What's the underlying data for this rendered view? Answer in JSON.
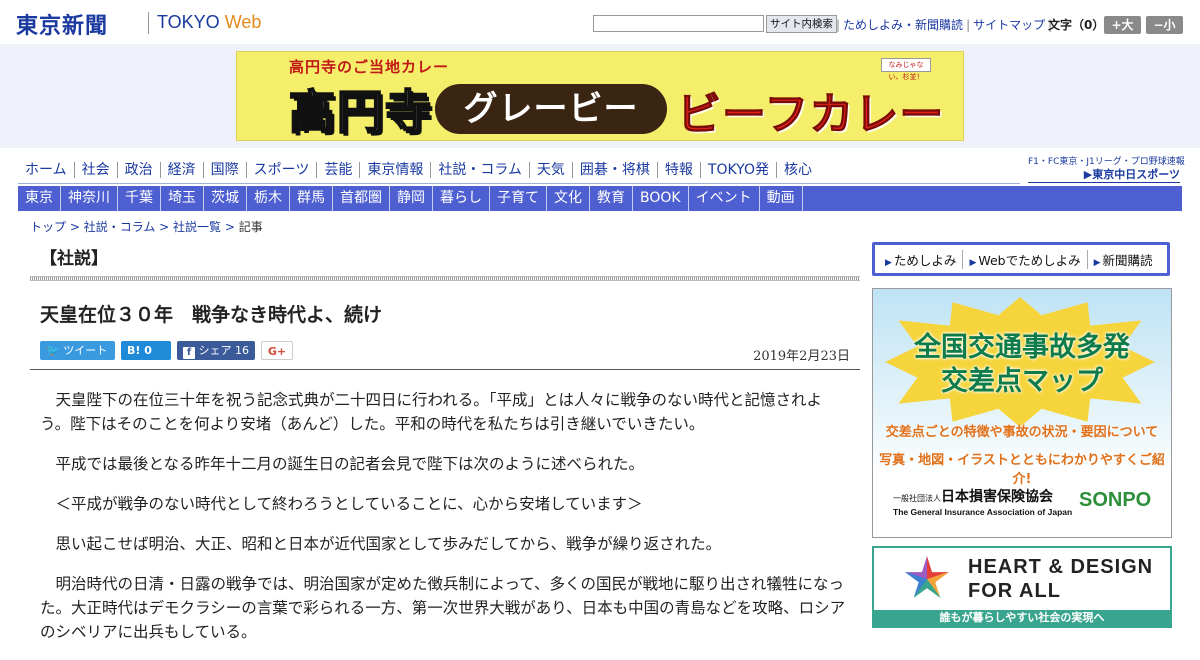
{
  "header": {
    "logo_jp": "東京新聞",
    "logo_en": "TOKYO",
    "logo_web": "Web",
    "search_placeholder": "",
    "search_button": "サイト内検索",
    "links": [
      "ためしよみ・新聞購読",
      "サイトマップ"
    ],
    "fontsize_label": "文字（0）",
    "fontsize_plus": "+大",
    "fontsize_minus": "−小"
  },
  "banner": {
    "sub": "高円寺のご当地カレー",
    "main": "高円寺",
    "gravy": "グレービー",
    "beef": "ビーフカレー",
    "badge": "なみじゃない、杉並！"
  },
  "nav_primary": [
    "ホーム",
    "社会",
    "政治",
    "経済",
    "国際",
    "スポーツ",
    "芸能",
    "東京情報",
    "社説・コラム",
    "天気",
    "囲碁・将棋",
    "特報",
    "TOKYO発",
    "核心"
  ],
  "nav_regional": [
    "東京",
    "神奈川",
    "千葉",
    "埼玉",
    "茨城",
    "栃木",
    "群馬",
    "首都圏",
    "静岡",
    "暮らし",
    "子育て",
    "文化",
    "教育",
    "BOOK",
    "イベント",
    "動画"
  ],
  "sports": {
    "top": "F1・FC東京・J1リーグ・プロ野球速報",
    "logo": "▶東京中日スポーツ"
  },
  "breadcrumb": {
    "items": [
      "トップ",
      "社説・コラム",
      "社説一覧"
    ],
    "current": "記事",
    "separator": " > "
  },
  "article": {
    "section": "【社説】",
    "headline": "天皇在位３０年　戦争なき時代よ、続け",
    "date": "2019年2月23日",
    "share": {
      "tweet": "ツイート",
      "hatena": "B! 0",
      "facebook_label": "シェア",
      "facebook_count": "16",
      "gplus": "G+"
    },
    "paragraphs": [
      "天皇陛下の在位三十年を祝う記念式典が二十四日に行われる。「平成」とは人々に戦争のない時代と記憶されよう。陛下はそのことを何より安堵（あんど）した。平和の時代を私たちは引き継いでいきたい。",
      "平成では最後となる昨年十二月の誕生日の記者会見で陛下は次のように述べられた。",
      "＜平成が戦争のない時代として終わろうとしていることに、心から安堵しています＞",
      "思い起こせば明治、大正、昭和と日本が近代国家として歩みだしてから、戦争が繰り返された。",
      "明治時代の日清・日露の戦争では、明治国家が定めた徴兵制によって、多くの国民が戦地に駆り出され犠牲になった。大正時代はデモクラシーの言葉で彩られる一方、第一次世界大戦があり、日本も中国の青島などを攻略、ロシアのシベリアに出兵もしている。"
    ]
  },
  "sidebar": {
    "links": [
      "ためしよみ",
      "Webでためしよみ",
      "新聞購読"
    ],
    "ad1": {
      "title1": "全国交通事故多発",
      "title2": "交差点マップ",
      "text1": "交差点ごとの特徴や事故の状況・要因について",
      "text2": "写真・地図・イラストとともにわかりやすくご紹介!",
      "org_prefix": "一般社団法人",
      "org": "日本損害保険協会",
      "org_en": "The General Insurance Association of Japan",
      "brand": "SONPO"
    },
    "ad2": {
      "line1": "HEART & DESIGN",
      "line2": "FOR ALL",
      "bar": "誰もが暮らしやすい社会の実現へ"
    }
  }
}
